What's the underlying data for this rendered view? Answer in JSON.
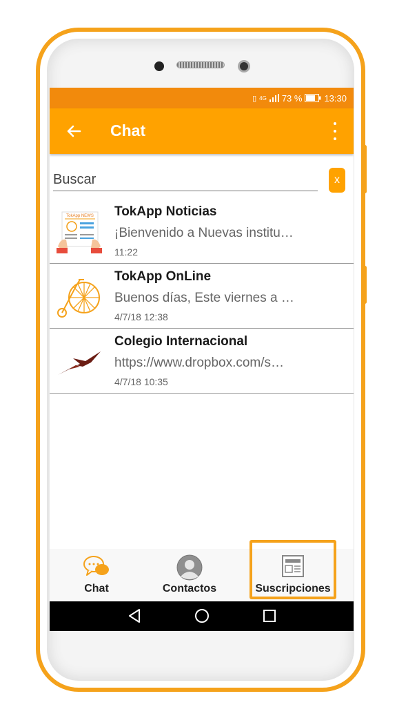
{
  "status_bar": {
    "battery": "73 %",
    "time": "13:30",
    "network": "4G"
  },
  "app_bar": {
    "title": "Chat"
  },
  "search": {
    "placeholder": "Buscar",
    "clear_label": "x"
  },
  "chats": [
    {
      "name": "TokApp Noticias",
      "message": "¡Bienvenido a Nuevas institu…",
      "time": "11:22",
      "icon": "newspaper-icon",
      "icon_text": "TokApp NEWS"
    },
    {
      "name": "TokApp OnLine",
      "message": "Buenos días, Este viernes a …",
      "time": "4/7/18 12:38",
      "icon": "bicycle-icon"
    },
    {
      "name": "Colegio Internacional",
      "message": "https://www.dropbox.com/s…",
      "time": "4/7/18 10:35",
      "icon": "swallow-icon"
    }
  ],
  "bottom_nav": [
    {
      "label": "Chat",
      "icon": "chat-bubbles-icon"
    },
    {
      "label": "Contactos",
      "icon": "contact-icon"
    },
    {
      "label": "Suscripciones",
      "icon": "subscriptions-icon",
      "highlighted": true
    }
  ],
  "colors": {
    "accent": "#ffa200",
    "status_bar": "#f28a0c",
    "frame": "#f5a21b"
  }
}
